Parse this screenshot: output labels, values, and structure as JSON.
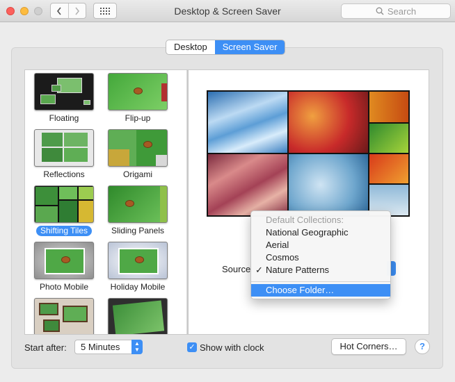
{
  "window": {
    "title": "Desktop & Screen Saver"
  },
  "search": {
    "placeholder": "Search"
  },
  "tabs": [
    {
      "label": "Desktop",
      "active": false
    },
    {
      "label": "Screen Saver",
      "active": true
    }
  ],
  "screensavers": [
    {
      "label": "Floating",
      "selected": false
    },
    {
      "label": "Flip-up",
      "selected": false
    },
    {
      "label": "Reflections",
      "selected": false
    },
    {
      "label": "Origami",
      "selected": false
    },
    {
      "label": "Shifting Tiles",
      "selected": true
    },
    {
      "label": "Sliding Panels",
      "selected": false
    },
    {
      "label": "Photo Mobile",
      "selected": false
    },
    {
      "label": "Holiday Mobile",
      "selected": false
    },
    {
      "label": "",
      "selected": false
    },
    {
      "label": "",
      "selected": false
    }
  ],
  "source": {
    "label": "Source",
    "menu": {
      "header": "Default Collections:",
      "items": [
        {
          "label": "National Geographic",
          "checked": false
        },
        {
          "label": "Aerial",
          "checked": false
        },
        {
          "label": "Cosmos",
          "checked": false
        },
        {
          "label": "Nature Patterns",
          "checked": true
        }
      ],
      "action": "Choose Folder…"
    },
    "check_mark": "✓"
  },
  "bottom": {
    "start_after_label": "Start after:",
    "start_after_value": "5 Minutes",
    "show_clock_label": "Show with clock",
    "show_clock_checked": true,
    "hot_corners_label": "Hot Corners…",
    "help_label": "?"
  },
  "colors": {
    "accent": "#3d8ff5"
  }
}
